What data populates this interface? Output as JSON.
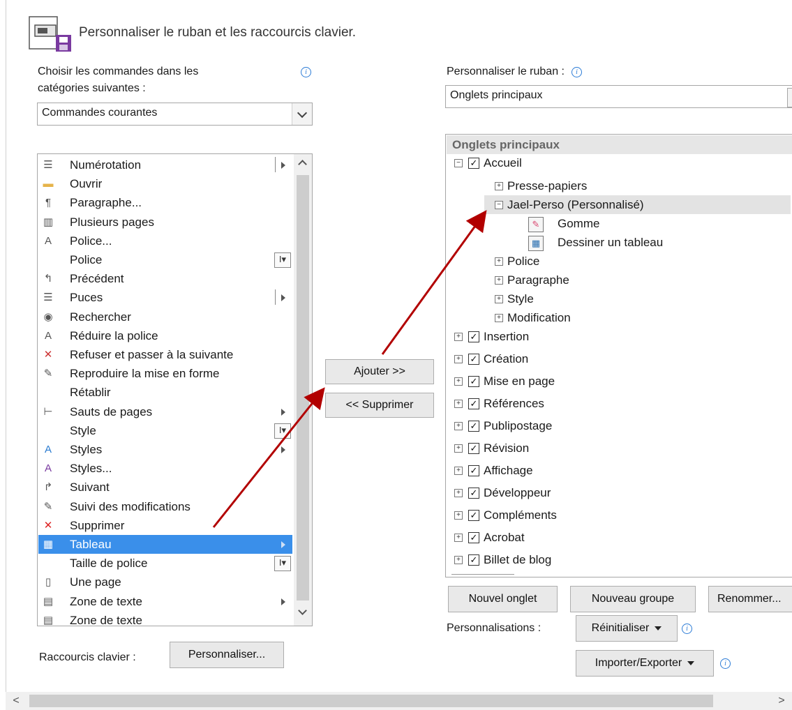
{
  "header": {
    "title": "Personnaliser le ruban et les raccourcis clavier."
  },
  "left": {
    "choose_label_line1": "Choisir les commandes dans les",
    "choose_label_line2": "catégories suivantes :",
    "category_value": "Commandes courantes",
    "commands": [
      {
        "label": "Numérotation",
        "icon": "numbering-icon"
      },
      {
        "label": "Ouvrir",
        "icon": "open-folder-icon"
      },
      {
        "label": "Paragraphe...",
        "icon": "paragraph-icon"
      },
      {
        "label": "Plusieurs pages",
        "icon": "multiple-pages-icon"
      },
      {
        "label": "Police...",
        "icon": "font-icon"
      },
      {
        "label": "Police",
        "icon": ""
      },
      {
        "label": "Précédent",
        "icon": "previous-icon"
      },
      {
        "label": "Puces",
        "icon": "bullets-icon"
      },
      {
        "label": "Rechercher",
        "icon": "binoculars-icon"
      },
      {
        "label": "Réduire la police",
        "icon": "shrink-font-icon"
      },
      {
        "label": "Refuser et passer à la suivante",
        "icon": "reject-change-icon"
      },
      {
        "label": "Reproduire la mise en forme",
        "icon": "format-painter-icon"
      },
      {
        "label": "Rétablir",
        "icon": ""
      },
      {
        "label": "Sauts de pages",
        "icon": "page-break-icon"
      },
      {
        "label": "Style",
        "icon": ""
      },
      {
        "label": "Styles",
        "icon": "styles-icon"
      },
      {
        "label": "Styles...",
        "icon": "styles-dialog-icon"
      },
      {
        "label": "Suivant",
        "icon": "next-icon"
      },
      {
        "label": "Suivi des modifications",
        "icon": "track-changes-icon"
      },
      {
        "label": "Supprimer",
        "icon": "delete-icon"
      },
      {
        "label": "Tableau",
        "icon": "table-icon"
      },
      {
        "label": "Taille de police",
        "icon": ""
      },
      {
        "label": "Une page",
        "icon": "one-page-icon"
      },
      {
        "label": "Zone de texte",
        "icon": "textbox-icon"
      },
      {
        "label": "Zone de texte",
        "icon": "textbox-icon"
      }
    ],
    "keyboard_label": "Raccourcis clavier :",
    "customize_button": "Personnaliser..."
  },
  "middle": {
    "add_button": "Ajouter >>",
    "remove_button": "<< Supprimer"
  },
  "right": {
    "ribbon_label": "Personnaliser le ruban :",
    "ribbon_value": "Onglets principaux",
    "tree_header": "Onglets principaux",
    "tree": [
      {
        "label": "Accueil",
        "level": 0,
        "pm": "−",
        "checked": true
      },
      {
        "label": "Presse-papiers",
        "level": 1,
        "pm": "+",
        "checked": false
      },
      {
        "label": "Jael-Perso (Personnalisé)",
        "level": 1,
        "pm": "−",
        "checked": false
      },
      {
        "label": "Gomme",
        "level": 2,
        "pm": "",
        "checked": false
      },
      {
        "label": "Dessiner un tableau",
        "level": 2,
        "pm": "",
        "checked": false
      },
      {
        "label": "Police",
        "level": 1,
        "pm": "+",
        "checked": false
      },
      {
        "label": "Paragraphe",
        "level": 1,
        "pm": "+",
        "checked": false
      },
      {
        "label": "Style",
        "level": 1,
        "pm": "+",
        "checked": false
      },
      {
        "label": "Modification",
        "level": 1,
        "pm": "+",
        "checked": false
      },
      {
        "label": "Insertion",
        "level": 0,
        "pm": "+",
        "checked": true
      },
      {
        "label": "Création",
        "level": 0,
        "pm": "+",
        "checked": true
      },
      {
        "label": "Mise en page",
        "level": 0,
        "pm": "+",
        "checked": true
      },
      {
        "label": "Références",
        "level": 0,
        "pm": "+",
        "checked": true
      },
      {
        "label": "Publipostage",
        "level": 0,
        "pm": "+",
        "checked": true
      },
      {
        "label": "Révision",
        "level": 0,
        "pm": "+",
        "checked": true
      },
      {
        "label": "Affichage",
        "level": 0,
        "pm": "+",
        "checked": true
      },
      {
        "label": "Développeur",
        "level": 0,
        "pm": "+",
        "checked": true
      },
      {
        "label": "Compléments",
        "level": 0,
        "pm": "+",
        "checked": true
      },
      {
        "label": "Acrobat",
        "level": 0,
        "pm": "+",
        "checked": true
      },
      {
        "label": "Billet de blog",
        "level": 0,
        "pm": "+",
        "checked": true
      }
    ],
    "new_tab_button": "Nouvel onglet",
    "new_group_button": "Nouveau groupe",
    "rename_button": "Renommer...",
    "customizations_label": "Personnalisations :",
    "reset_button": "Réinitialiser",
    "import_export_button": "Importer/Exporter"
  },
  "colors": {
    "selection": "#3a8fea",
    "annotation_arrow": "#b20000",
    "accent_info": "#2b7bd6"
  }
}
